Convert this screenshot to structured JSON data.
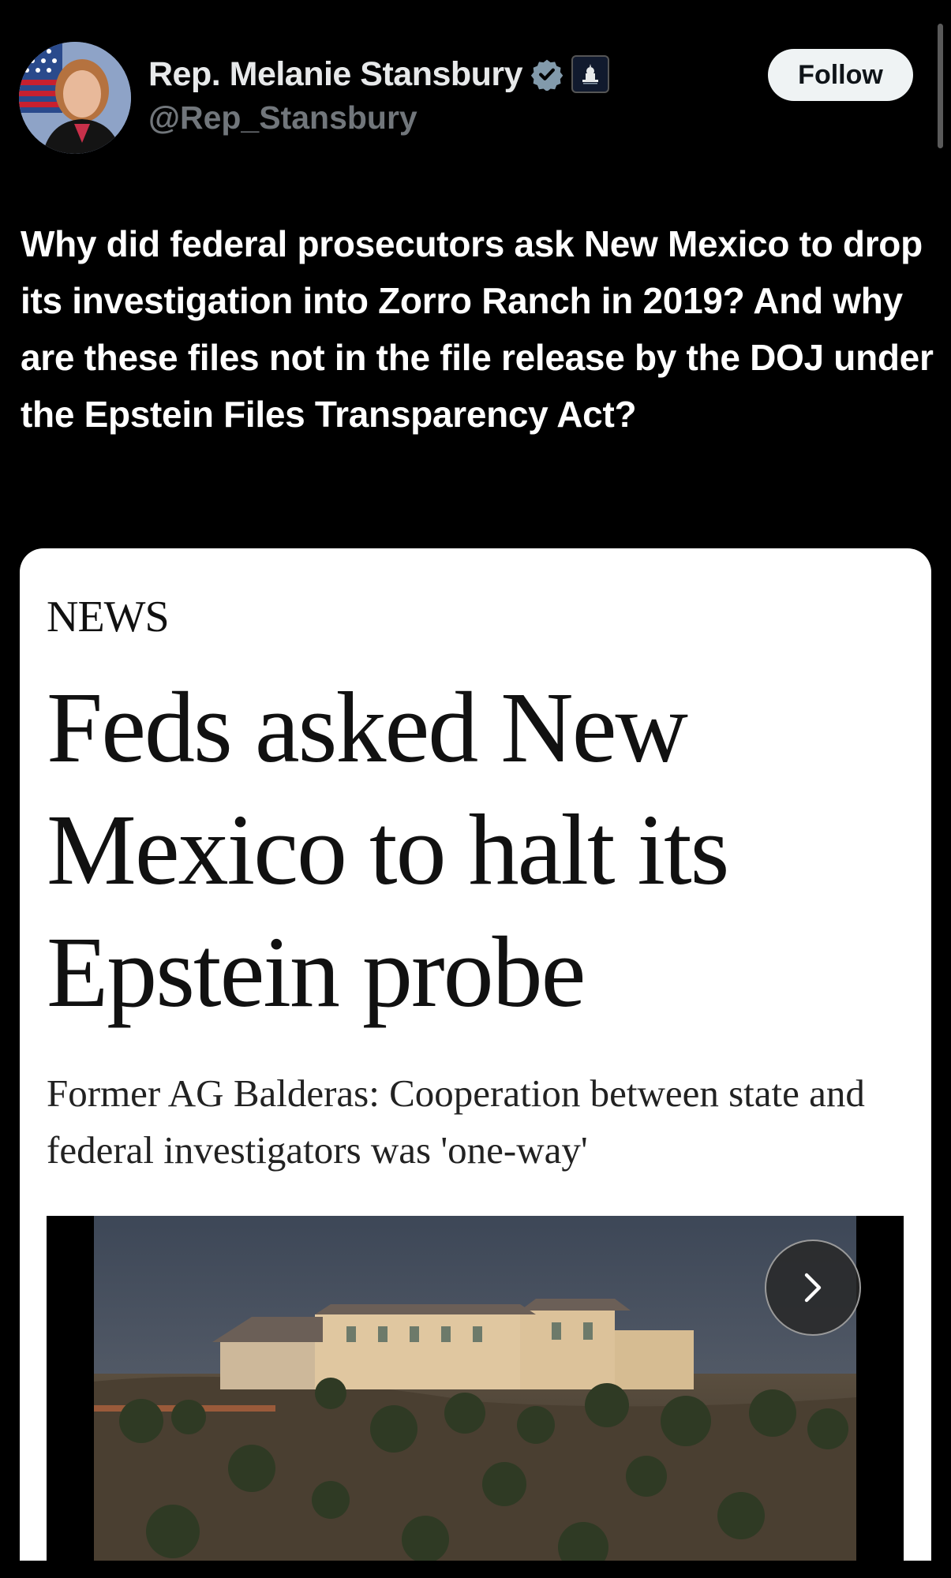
{
  "author": {
    "display_name": "Rep. Melanie Stansbury",
    "handle": "@Rep_Stansbury",
    "verified_icon": "verified-badge-icon",
    "affiliation_icon": "capitol-building-icon"
  },
  "follow_label": "Follow",
  "post": {
    "text": "Why did federal prosecutors ask New Mexico to drop its investigation into Zorro Ranch in 2019? And why are these files not in the file release by the DOJ under the Epstein Files Transparency Act?"
  },
  "article": {
    "section": "NEWS",
    "headline": "Feds asked New Mexico to halt its Epstein probe",
    "subhead": "Former AG Balderas: Cooperation between state and federal investigators was 'one-way'",
    "next_icon": "chevron-right-icon"
  },
  "colors": {
    "background": "#000000",
    "text_primary": "#e7e9ea",
    "text_secondary": "#71767b",
    "verified": "#829aab",
    "card": "#ffffff"
  }
}
